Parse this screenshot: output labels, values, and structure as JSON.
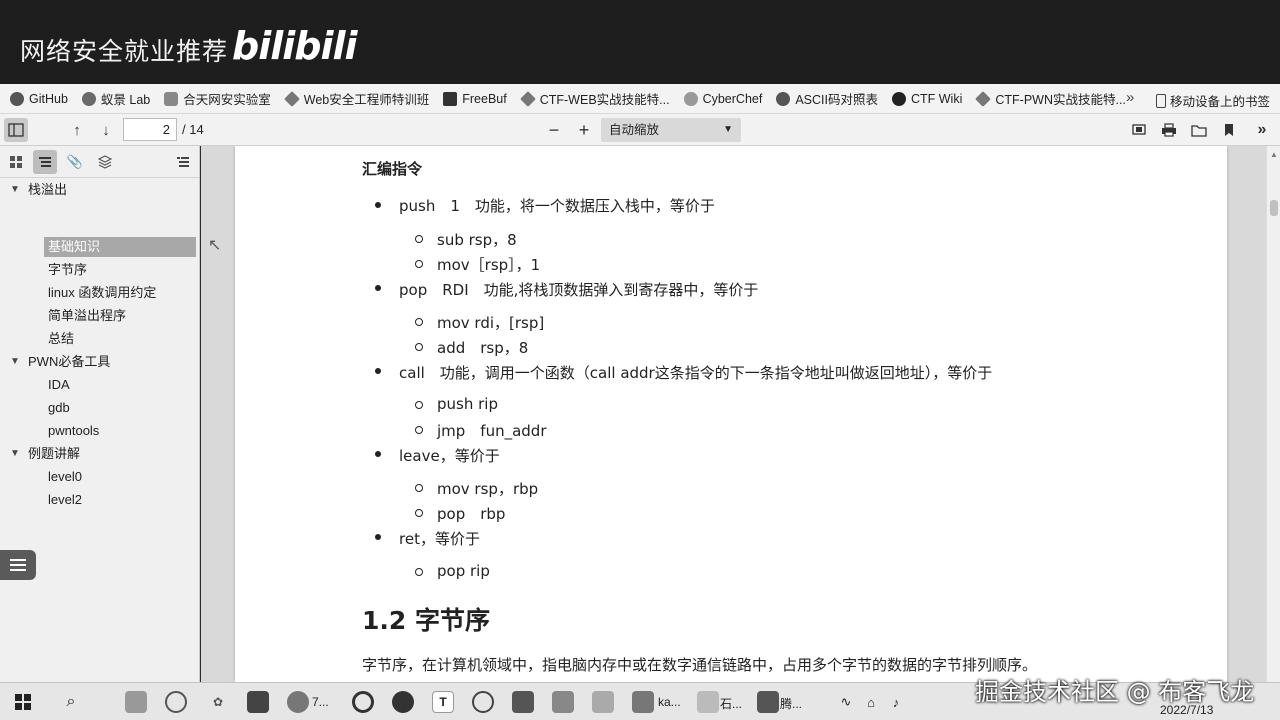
{
  "banner": {
    "title": "网络安全就业推荐",
    "logo": "bilibili"
  },
  "bookmarks": {
    "items": [
      "GitHub",
      "蚁景 Lab",
      "合天网安实验室",
      "Web安全工程师特训班",
      "FreeBuf",
      "CTF-WEB实战技能特...",
      "CyberChef",
      "ASCII码对照表",
      "CTF Wiki",
      "CTF-PWN实战技能特..."
    ],
    "more": "»",
    "mobile": "移动设备上的书签"
  },
  "toolbar": {
    "page_current": "2",
    "page_total": "/ 14",
    "zoom": "自动缩放"
  },
  "sidebar": {
    "outline": [
      {
        "label": "栈溢出",
        "level": 0
      },
      {
        "label": "基础知识",
        "level": 1,
        "selected": true
      },
      {
        "label": "字节序",
        "level": 1
      },
      {
        "label": "linux 函数调用约定",
        "level": 1
      },
      {
        "label": "简单溢出程序",
        "level": 1
      },
      {
        "label": "总结",
        "level": 1
      },
      {
        "label": "PWN必备工具",
        "level": 0
      },
      {
        "label": "IDA",
        "level": 1
      },
      {
        "label": "gdb",
        "level": 1
      },
      {
        "label": "pwntools",
        "level": 1
      },
      {
        "label": "例题讲解",
        "level": 0
      },
      {
        "label": "level0",
        "level": 1
      },
      {
        "label": "level2",
        "level": 1
      }
    ]
  },
  "doc": {
    "subheading": "汇编指令",
    "push": "push　1　功能，将一个数据压入栈中，等价于",
    "push_1": "sub rsp，8",
    "push_2": "mov［rsp］，1",
    "pop": "pop　RDI　功能,将栈顶数据弹入到寄存器中，等价于",
    "pop_1": "mov rdi，[rsp]",
    "pop_2": "add　rsp，8",
    "call": "call　功能，调用一个函数（call addr这条指令的下一条指令地址叫做返回地址），等价于",
    "call_1": "push rip",
    "call_2": "jmp　fun_addr",
    "leave": "leave，等价于",
    "leave_1": "mov rsp，rbp",
    "leave_2": "pop　rbp",
    "ret": "ret，等价于",
    "ret_1": "pop rip",
    "section": "1.2 字节序",
    "para": "字节序，在计算机领域中，指电脑内存中或在数字通信链路中，占用多个字节的数据的字节排列顺序。"
  },
  "taskbar": {
    "items": [
      "7...",
      "ka...",
      "石...",
      "腾..."
    ],
    "date": "2022/7/13"
  },
  "watermark": "掘金技术社区 @ 布客飞龙"
}
